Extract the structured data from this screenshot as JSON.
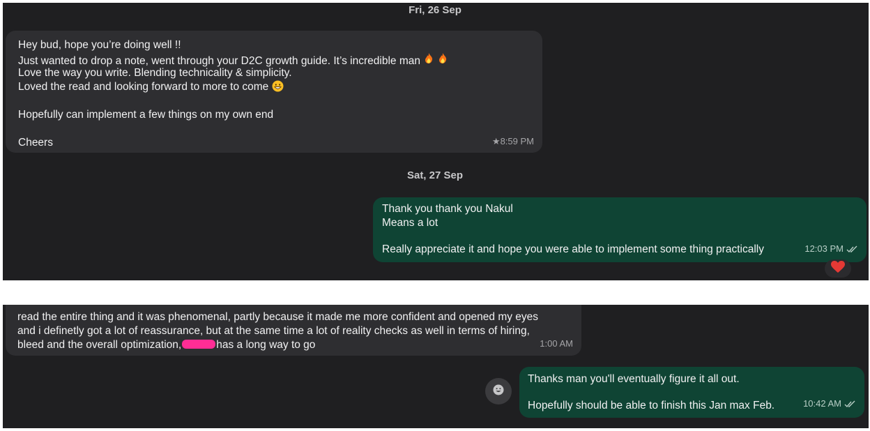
{
  "top": {
    "date1": "Fri, 26 Sep",
    "msg1": {
      "lines": [
        "Hey bud, hope you’re doing well !!",
        "Just wanted to drop a note, went through your D2C growth guide. It’s incredible man",
        "Love the way you write. Blending technicality & simplicity.",
        "Loved the read and looking forward to more to come",
        "",
        "Hopefully can implement a few things on my own end",
        "",
        "Cheers"
      ],
      "time": "8:59 PM",
      "starred_icon": "star-icon",
      "emoji_icons": [
        "fire-emoji-icon",
        "fire-emoji-icon",
        "grinning-face-emoji-icon"
      ]
    },
    "date2": "Sat, 27 Sep",
    "msg2": {
      "lines": [
        "Thank you thank you Nakul",
        "Means a lot",
        "",
        "Really appreciate it and hope you were able to implement some thing practically"
      ],
      "time": "12:03 PM",
      "status_icon": "double-check-icon",
      "reaction": "red-heart-icon"
    }
  },
  "bottom": {
    "msg3": {
      "line1": "read the entire thing and it was phenomenal, partly because it made me more confident and opened my eyes",
      "line2": "and i definetly got a lot of reassurance, but at the same time a lot of reality checks as well in terms of hiring,",
      "line3_before": "bleed and the overall optimization,",
      "line3_after": "has a long way to go",
      "time": "1:00 AM"
    },
    "msg4": {
      "lines": [
        "Thanks man you'll eventually figure it all out.",
        "",
        "Hopefully should be able to finish this Jan max Feb."
      ],
      "time": "10:42 AM",
      "status_icon": "double-check-icon"
    },
    "emoji_button_icon": "smiley-icon"
  },
  "colors": {
    "chat_background": "#1f1f21",
    "incoming_bubble": "#2e2e31",
    "outgoing_bubble": "#0f4434",
    "redaction": "#ff2d95"
  }
}
